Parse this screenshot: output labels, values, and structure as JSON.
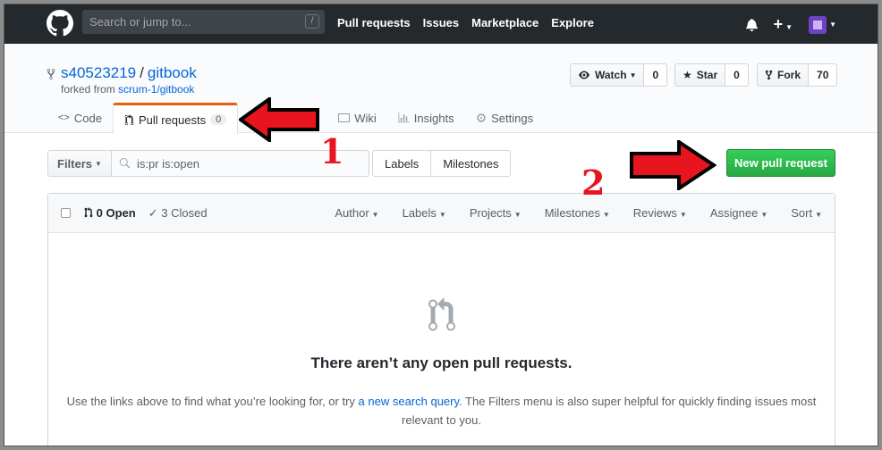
{
  "header": {
    "search_placeholder": "Search or jump to...",
    "slash_key": "/",
    "nav": [
      "Pull requests",
      "Issues",
      "Marketplace",
      "Explore"
    ],
    "plus": "+"
  },
  "repo": {
    "owner": "s40523219",
    "separator": "/",
    "name": "gitbook",
    "forked_prefix": "forked from",
    "forked_source": "scrum-1/gitbook",
    "watch_label": "Watch",
    "watch_count": "0",
    "star_label": "Star",
    "star_count": "0",
    "fork_label": "Fork",
    "fork_count": "70"
  },
  "tabs": {
    "code": "Code",
    "pull_requests": "Pull requests",
    "pull_requests_count": "0",
    "wiki": "Wiki",
    "insights": "Insights",
    "settings": "Settings"
  },
  "subnav": {
    "filters_label": "Filters",
    "query": "is:pr is:open",
    "labels": "Labels",
    "milestones": "Milestones",
    "new_pr": "New pull request"
  },
  "list": {
    "open": "0 Open",
    "closed": "3 Closed",
    "filters": [
      "Author",
      "Labels",
      "Projects",
      "Milestones",
      "Reviews",
      "Assignee",
      "Sort"
    ]
  },
  "blankslate": {
    "title": "There aren’t any open pull requests.",
    "text_before": "Use the links above to find what you’re looking for, or try ",
    "link": "a new search query",
    "text_after": ". The Filters menu is also super helpful for quickly finding issues most relevant to you."
  },
  "annotations": {
    "num1": "1",
    "num2": "2",
    "color": "#e8141e"
  }
}
